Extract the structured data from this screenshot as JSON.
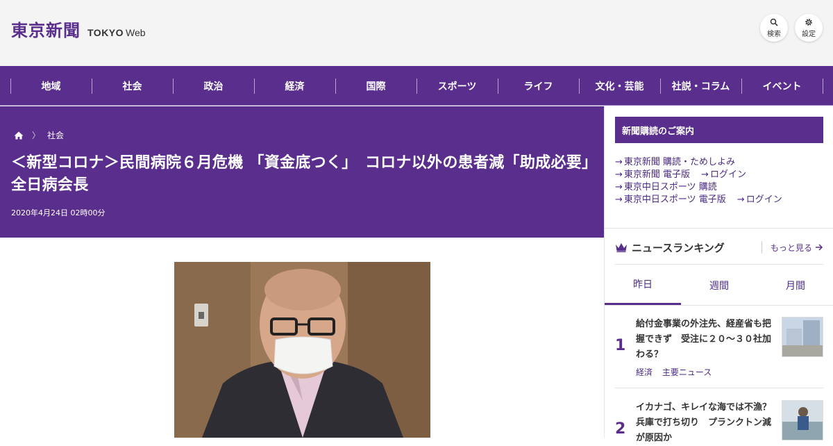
{
  "header": {
    "logo_jp": "東京新聞",
    "logo_en_bold": "TOKYO",
    "logo_en_light": "Web",
    "search_label": "検索",
    "settings_label": "設定"
  },
  "nav": [
    "地域",
    "社会",
    "政治",
    "経済",
    "国際",
    "スポーツ",
    "ライフ",
    "文化・芸能",
    "社説・コラム",
    "イベント"
  ],
  "article": {
    "breadcrumb": "社会",
    "title": "＜新型コロナ＞民間病院６月危機 「資金底つく」　コロナ以外の患者減「助成必要」 全日病会長",
    "date": "2020年4月24日 02時00分"
  },
  "sidebar": {
    "subscription_heading": "新聞購読のご案内",
    "links": [
      [
        "東京新聞 購読・ためしよみ"
      ],
      [
        "東京新聞 電子版",
        "ログイン"
      ],
      [
        "東京中日スポーツ 購読"
      ],
      [
        "東京中日スポーツ 電子版",
        "ログイン"
      ]
    ],
    "ranking_title": "ニュースランキング",
    "more_label": "もっと見る",
    "tabs": [
      "昨日",
      "週間",
      "月間"
    ],
    "active_tab": 0,
    "items": [
      {
        "rank": "1",
        "title": "給付金事業の外注先、経産省も把握できず　受注に２０～３０社加わる？",
        "tags": [
          "経済",
          "主要ニュース"
        ]
      },
      {
        "rank": "2",
        "title": "イカナゴ、キレイな海では不漁？　兵庫で打ち切り　プランクトン減が原因か",
        "tags": []
      }
    ]
  },
  "colors": {
    "brand_purple": "#5a2e8c",
    "header_bg": "#f4f4f4"
  },
  "icons": [
    "search-icon",
    "gear-icon",
    "home-icon",
    "crown-icon",
    "arrow-right-icon"
  ]
}
